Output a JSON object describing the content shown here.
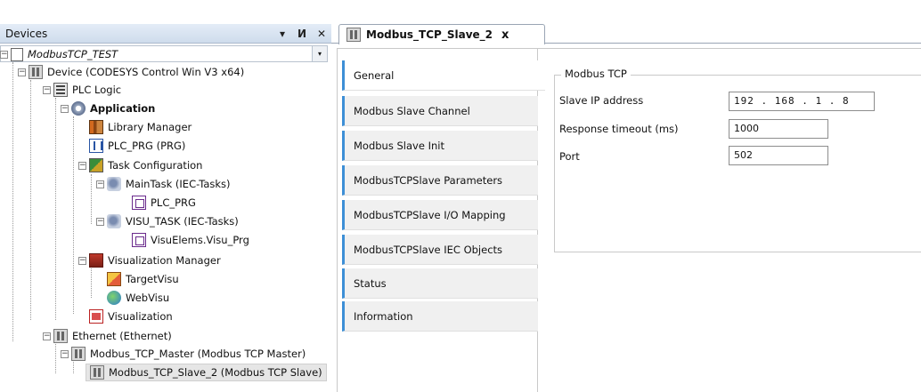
{
  "devices_panel": {
    "title": "Devices",
    "pin_glyph": "И",
    "close_glyph": "✕",
    "dropdown_glyph": "▾",
    "tree": [
      {
        "label": "ModbusTCP_TEST",
        "icon": "project-icon"
      },
      {
        "label": "Device (CODESYS Control Win V3 x64)",
        "icon": "device-icon"
      },
      {
        "label": "PLC Logic",
        "icon": "plc-logic-icon"
      },
      {
        "label": "Application",
        "icon": "application-icon"
      },
      {
        "label": "Library Manager",
        "icon": "library-icon"
      },
      {
        "label": "PLC_PRG (PRG)",
        "icon": "program-icon"
      },
      {
        "label": "Task Configuration",
        "icon": "task-config-icon"
      },
      {
        "label": "MainTask (IEC-Tasks)",
        "icon": "task-icon"
      },
      {
        "label": "PLC_PRG",
        "icon": "program-call-icon"
      },
      {
        "label": "VISU_TASK (IEC-Tasks)",
        "icon": "task-icon"
      },
      {
        "label": "VisuElems.Visu_Prg",
        "icon": "program-call-icon"
      },
      {
        "label": "Visualization Manager",
        "icon": "visu-manager-icon"
      },
      {
        "label": "TargetVisu",
        "icon": "target-visu-icon"
      },
      {
        "label": "WebVisu",
        "icon": "web-visu-icon"
      },
      {
        "label": "Visualization",
        "icon": "visualization-icon"
      },
      {
        "label": "Ethernet (Ethernet)",
        "icon": "ethernet-icon"
      },
      {
        "label": "Modbus_TCP_Master (Modbus TCP Master)",
        "icon": "modbus-master-icon"
      },
      {
        "label": "Modbus_TCP_Slave_2 (Modbus TCP Slave)",
        "icon": "modbus-slave-icon"
      }
    ]
  },
  "editor": {
    "tab_label": "Modbus_TCP_Slave_2",
    "tab_close": "x",
    "side_tabs": [
      {
        "label": "General"
      },
      {
        "label": "Modbus Slave Channel"
      },
      {
        "label": "Modbus Slave Init"
      },
      {
        "label": "ModbusTCPSlave Parameters"
      },
      {
        "label": "ModbusTCPSlave I/O Mapping"
      },
      {
        "label": "ModbusTCPSlave IEC Objects"
      },
      {
        "label": "Status"
      },
      {
        "label": "Information"
      }
    ],
    "group_title": "Modbus TCP",
    "fields": {
      "ip_label": "Slave IP address",
      "ip_value": "192 . 168 . 1 . 8",
      "timeout_label": "Response timeout (ms)",
      "timeout_value": "1000",
      "port_label": "Port",
      "port_value": "502"
    }
  },
  "colors": {
    "tab_accent": "#3d8fd6",
    "header_bg": "#cfdcec"
  }
}
